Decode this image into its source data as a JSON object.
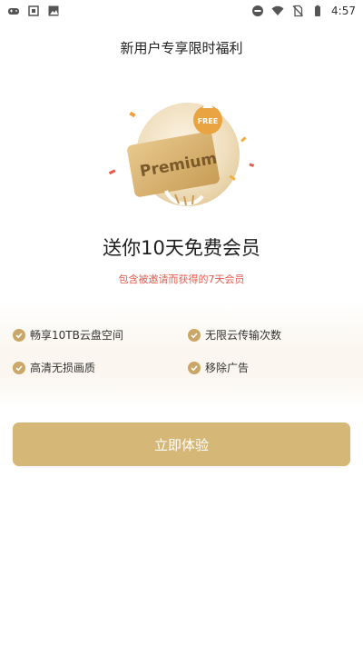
{
  "status_bar": {
    "time": "4:57",
    "left_icons": [
      "gamepad-icon",
      "app-notification-icon",
      "photo-icon"
    ],
    "right_icons": [
      "do-not-disturb-icon",
      "wifi-icon",
      "no-sim-icon",
      "battery-icon"
    ]
  },
  "page": {
    "title": "新用户专享限时福利",
    "headline": "送你10天免费会员",
    "subline": "包含被邀请而获得的7天会员"
  },
  "hero": {
    "card_text": "Premium",
    "badge_text": "FREE"
  },
  "features": [
    {
      "label": "畅享10TB云盘空间"
    },
    {
      "label": "无限云传输次数"
    },
    {
      "label": "高清无损画质"
    },
    {
      "label": "移除广告"
    }
  ],
  "cta": {
    "label": "立即体验"
  },
  "colors": {
    "accent": "#d5b778",
    "check": "#caa769",
    "subline": "#e85b4d"
  }
}
